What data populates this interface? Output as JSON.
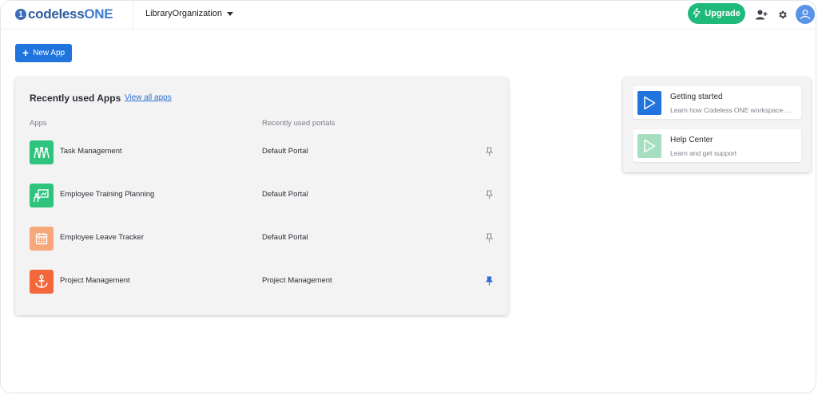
{
  "header": {
    "logo_mark": "1",
    "logo_text": "codeless",
    "logo_text_accent": "ONE",
    "org_name": "LibraryOrganization",
    "upgrade_label": "Upgrade"
  },
  "toolbar": {
    "new_app_label": "New App"
  },
  "recent": {
    "title": "Recently used Apps",
    "view_all_label": "View all apps",
    "col_apps": "Apps",
    "col_portals": "Recently used portals",
    "rows": [
      {
        "app": "Task Management",
        "portal": "Default Portal",
        "icon": "team-icon",
        "color": "#2ec47e",
        "pinned": false
      },
      {
        "app": "Employee Training Planning",
        "portal": "Default Portal",
        "icon": "presentation-icon",
        "color": "#2ec47e",
        "pinned": false
      },
      {
        "app": "Employee Leave Tracker",
        "portal": "Default Portal",
        "icon": "calendar-icon",
        "color": "#f7a87a",
        "pinned": false
      },
      {
        "app": "Project Management",
        "portal": "Project Management",
        "icon": "anchor-icon",
        "color": "#f2683a",
        "pinned": true
      }
    ]
  },
  "help": {
    "items": [
      {
        "title": "Getting started",
        "subtitle": "Learn how Codeless ONE workspace works",
        "icon": "play-icon",
        "color": "#1f74de"
      },
      {
        "title": "Help Center",
        "subtitle": "Learn and get support",
        "icon": "play-icon",
        "color": "#a5dfbf"
      }
    ]
  },
  "colors": {
    "accent": "#1f74de",
    "upgrade": "#1fb97b",
    "pin_active": "#2f6fd3",
    "pin_inactive": "#8a8f98"
  }
}
